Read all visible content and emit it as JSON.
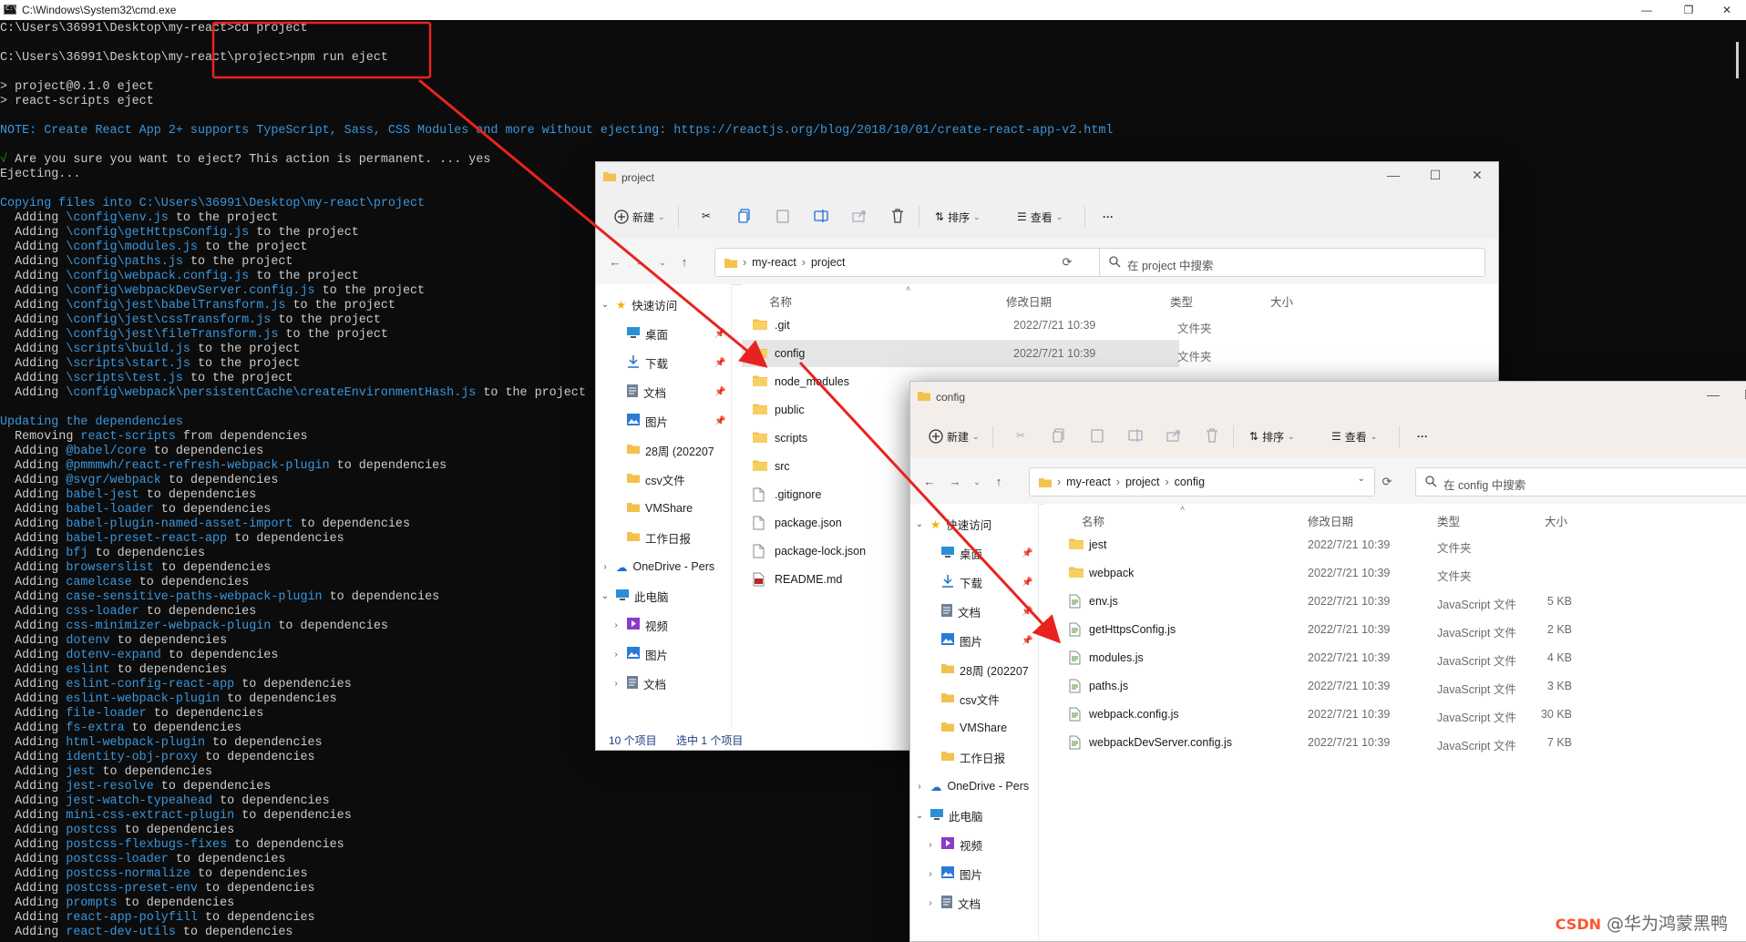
{
  "cmd": {
    "title": "C:\\Windows\\System32\\cmd.exe",
    "controls": {
      "minimize": "—",
      "maximize": "❐",
      "close": "✕"
    },
    "lines": [
      [
        {
          "t": "C:\\Users\\36991\\Desktop\\my-react>cd project",
          "c": ""
        }
      ],
      [
        {
          "t": "",
          "c": ""
        }
      ],
      [
        {
          "t": "C:\\Users\\36991\\Desktop\\my-react\\project>npm run eject",
          "c": ""
        }
      ],
      [
        {
          "t": "",
          "c": ""
        }
      ],
      [
        {
          "t": "> project@0.1.0 eject",
          "c": ""
        }
      ],
      [
        {
          "t": "> react-scripts eject",
          "c": ""
        }
      ],
      [
        {
          "t": "",
          "c": ""
        }
      ],
      [
        {
          "t": "NOTE: Create React App 2+ supports TypeScript, Sass, CSS Modules and more without ejecting: https://reactjs.org/blog/2018/10/01/create-react-app-v2.html",
          "c": "c-cyan"
        }
      ],
      [
        {
          "t": "",
          "c": ""
        }
      ],
      [
        {
          "t": "√ ",
          "c": "c-green"
        },
        {
          "t": "Are you sure you want to eject? This action is permanent. ... yes",
          "c": ""
        }
      ],
      [
        {
          "t": "Ejecting...",
          "c": ""
        }
      ],
      [
        {
          "t": "",
          "c": ""
        }
      ],
      [
        {
          "t": "Copying files into C:\\Users\\36991\\Desktop\\my-react\\project",
          "c": "c-cyan"
        }
      ],
      [
        {
          "t": "  Adding ",
          "c": ""
        },
        {
          "t": "\\config\\env.js",
          "c": "c-cyan"
        },
        {
          "t": " to the project",
          "c": ""
        }
      ],
      [
        {
          "t": "  Adding ",
          "c": ""
        },
        {
          "t": "\\config\\getHttpsConfig.js",
          "c": "c-cyan"
        },
        {
          "t": " to the project",
          "c": ""
        }
      ],
      [
        {
          "t": "  Adding ",
          "c": ""
        },
        {
          "t": "\\config\\modules.js",
          "c": "c-cyan"
        },
        {
          "t": " to the project",
          "c": ""
        }
      ],
      [
        {
          "t": "  Adding ",
          "c": ""
        },
        {
          "t": "\\config\\paths.js",
          "c": "c-cyan"
        },
        {
          "t": " to the project",
          "c": ""
        }
      ],
      [
        {
          "t": "  Adding ",
          "c": ""
        },
        {
          "t": "\\config\\webpack.config.js",
          "c": "c-cyan"
        },
        {
          "t": " to the project",
          "c": ""
        }
      ],
      [
        {
          "t": "  Adding ",
          "c": ""
        },
        {
          "t": "\\config\\webpackDevServer.config.js",
          "c": "c-cyan"
        },
        {
          "t": " to the project",
          "c": ""
        }
      ],
      [
        {
          "t": "  Adding ",
          "c": ""
        },
        {
          "t": "\\config\\jest\\babelTransform.js",
          "c": "c-cyan"
        },
        {
          "t": " to the project",
          "c": ""
        }
      ],
      [
        {
          "t": "  Adding ",
          "c": ""
        },
        {
          "t": "\\config\\jest\\cssTransform.js",
          "c": "c-cyan"
        },
        {
          "t": " to the project",
          "c": ""
        }
      ],
      [
        {
          "t": "  Adding ",
          "c": ""
        },
        {
          "t": "\\config\\jest\\fileTransform.js",
          "c": "c-cyan"
        },
        {
          "t": " to the project",
          "c": ""
        }
      ],
      [
        {
          "t": "  Adding ",
          "c": ""
        },
        {
          "t": "\\scripts\\build.js",
          "c": "c-cyan"
        },
        {
          "t": " to the project",
          "c": ""
        }
      ],
      [
        {
          "t": "  Adding ",
          "c": ""
        },
        {
          "t": "\\scripts\\start.js",
          "c": "c-cyan"
        },
        {
          "t": " to the project",
          "c": ""
        }
      ],
      [
        {
          "t": "  Adding ",
          "c": ""
        },
        {
          "t": "\\scripts\\test.js",
          "c": "c-cyan"
        },
        {
          "t": " to the project",
          "c": ""
        }
      ],
      [
        {
          "t": "  Adding ",
          "c": ""
        },
        {
          "t": "\\config\\webpack\\persistentCache\\createEnvironmentHash.js",
          "c": "c-cyan"
        },
        {
          "t": " to the project",
          "c": ""
        }
      ],
      [
        {
          "t": "",
          "c": ""
        }
      ],
      [
        {
          "t": "Updating the dependencies",
          "c": "c-cyan"
        }
      ],
      [
        {
          "t": "  Removing ",
          "c": ""
        },
        {
          "t": "react-scripts",
          "c": "c-cyan"
        },
        {
          "t": " from dependencies",
          "c": ""
        }
      ],
      [
        {
          "t": "  Adding ",
          "c": ""
        },
        {
          "t": "@babel/core",
          "c": "c-cyan"
        },
        {
          "t": " to dependencies",
          "c": ""
        }
      ],
      [
        {
          "t": "  Adding ",
          "c": ""
        },
        {
          "t": "@pmmmwh/react-refresh-webpack-plugin",
          "c": "c-cyan"
        },
        {
          "t": " to dependencies",
          "c": ""
        }
      ],
      [
        {
          "t": "  Adding ",
          "c": ""
        },
        {
          "t": "@svgr/webpack",
          "c": "c-cyan"
        },
        {
          "t": " to dependencies",
          "c": ""
        }
      ],
      [
        {
          "t": "  Adding ",
          "c": ""
        },
        {
          "t": "babel-jest",
          "c": "c-cyan"
        },
        {
          "t": " to dependencies",
          "c": ""
        }
      ],
      [
        {
          "t": "  Adding ",
          "c": ""
        },
        {
          "t": "babel-loader",
          "c": "c-cyan"
        },
        {
          "t": " to dependencies",
          "c": ""
        }
      ],
      [
        {
          "t": "  Adding ",
          "c": ""
        },
        {
          "t": "babel-plugin-named-asset-import",
          "c": "c-cyan"
        },
        {
          "t": " to dependencies",
          "c": ""
        }
      ],
      [
        {
          "t": "  Adding ",
          "c": ""
        },
        {
          "t": "babel-preset-react-app",
          "c": "c-cyan"
        },
        {
          "t": " to dependencies",
          "c": ""
        }
      ],
      [
        {
          "t": "  Adding ",
          "c": ""
        },
        {
          "t": "bfj",
          "c": "c-cyan"
        },
        {
          "t": " to dependencies",
          "c": ""
        }
      ],
      [
        {
          "t": "  Adding ",
          "c": ""
        },
        {
          "t": "browserslist",
          "c": "c-cyan"
        },
        {
          "t": " to dependencies",
          "c": ""
        }
      ],
      [
        {
          "t": "  Adding ",
          "c": ""
        },
        {
          "t": "camelcase",
          "c": "c-cyan"
        },
        {
          "t": " to dependencies",
          "c": ""
        }
      ],
      [
        {
          "t": "  Adding ",
          "c": ""
        },
        {
          "t": "case-sensitive-paths-webpack-plugin",
          "c": "c-cyan"
        },
        {
          "t": " to dependencies",
          "c": ""
        }
      ],
      [
        {
          "t": "  Adding ",
          "c": ""
        },
        {
          "t": "css-loader",
          "c": "c-cyan"
        },
        {
          "t": " to dependencies",
          "c": ""
        }
      ],
      [
        {
          "t": "  Adding ",
          "c": ""
        },
        {
          "t": "css-minimizer-webpack-plugin",
          "c": "c-cyan"
        },
        {
          "t": " to dependencies",
          "c": ""
        }
      ],
      [
        {
          "t": "  Adding ",
          "c": ""
        },
        {
          "t": "dotenv",
          "c": "c-cyan"
        },
        {
          "t": " to dependencies",
          "c": ""
        }
      ],
      [
        {
          "t": "  Adding ",
          "c": ""
        },
        {
          "t": "dotenv-expand",
          "c": "c-cyan"
        },
        {
          "t": " to dependencies",
          "c": ""
        }
      ],
      [
        {
          "t": "  Adding ",
          "c": ""
        },
        {
          "t": "eslint",
          "c": "c-cyan"
        },
        {
          "t": " to dependencies",
          "c": ""
        }
      ],
      [
        {
          "t": "  Adding ",
          "c": ""
        },
        {
          "t": "eslint-config-react-app",
          "c": "c-cyan"
        },
        {
          "t": " to dependencies",
          "c": ""
        }
      ],
      [
        {
          "t": "  Adding ",
          "c": ""
        },
        {
          "t": "eslint-webpack-plugin",
          "c": "c-cyan"
        },
        {
          "t": " to dependencies",
          "c": ""
        }
      ],
      [
        {
          "t": "  Adding ",
          "c": ""
        },
        {
          "t": "file-loader",
          "c": "c-cyan"
        },
        {
          "t": " to dependencies",
          "c": ""
        }
      ],
      [
        {
          "t": "  Adding ",
          "c": ""
        },
        {
          "t": "fs-extra",
          "c": "c-cyan"
        },
        {
          "t": " to dependencies",
          "c": ""
        }
      ],
      [
        {
          "t": "  Adding ",
          "c": ""
        },
        {
          "t": "html-webpack-plugin",
          "c": "c-cyan"
        },
        {
          "t": " to dependencies",
          "c": ""
        }
      ],
      [
        {
          "t": "  Adding ",
          "c": ""
        },
        {
          "t": "identity-obj-proxy",
          "c": "c-cyan"
        },
        {
          "t": " to dependencies",
          "c": ""
        }
      ],
      [
        {
          "t": "  Adding ",
          "c": ""
        },
        {
          "t": "jest",
          "c": "c-cyan"
        },
        {
          "t": " to dependencies",
          "c": ""
        }
      ],
      [
        {
          "t": "  Adding ",
          "c": ""
        },
        {
          "t": "jest-resolve",
          "c": "c-cyan"
        },
        {
          "t": " to dependencies",
          "c": ""
        }
      ],
      [
        {
          "t": "  Adding ",
          "c": ""
        },
        {
          "t": "jest-watch-typeahead",
          "c": "c-cyan"
        },
        {
          "t": " to dependencies",
          "c": ""
        }
      ],
      [
        {
          "t": "  Adding ",
          "c": ""
        },
        {
          "t": "mini-css-extract-plugin",
          "c": "c-cyan"
        },
        {
          "t": " to dependencies",
          "c": ""
        }
      ],
      [
        {
          "t": "  Adding ",
          "c": ""
        },
        {
          "t": "postcss",
          "c": "c-cyan"
        },
        {
          "t": " to dependencies",
          "c": ""
        }
      ],
      [
        {
          "t": "  Adding ",
          "c": ""
        },
        {
          "t": "postcss-flexbugs-fixes",
          "c": "c-cyan"
        },
        {
          "t": " to dependencies",
          "c": ""
        }
      ],
      [
        {
          "t": "  Adding ",
          "c": ""
        },
        {
          "t": "postcss-loader",
          "c": "c-cyan"
        },
        {
          "t": " to dependencies",
          "c": ""
        }
      ],
      [
        {
          "t": "  Adding ",
          "c": ""
        },
        {
          "t": "postcss-normalize",
          "c": "c-cyan"
        },
        {
          "t": " to dependencies",
          "c": ""
        }
      ],
      [
        {
          "t": "  Adding ",
          "c": ""
        },
        {
          "t": "postcss-preset-env",
          "c": "c-cyan"
        },
        {
          "t": " to dependencies",
          "c": ""
        }
      ],
      [
        {
          "t": "  Adding ",
          "c": ""
        },
        {
          "t": "prompts",
          "c": "c-cyan"
        },
        {
          "t": " to dependencies",
          "c": ""
        }
      ],
      [
        {
          "t": "  Adding ",
          "c": ""
        },
        {
          "t": "react-app-polyfill",
          "c": "c-cyan"
        },
        {
          "t": " to dependencies",
          "c": ""
        }
      ],
      [
        {
          "t": "  Adding ",
          "c": ""
        },
        {
          "t": "react-dev-utils",
          "c": "c-cyan"
        },
        {
          "t": " to dependencies",
          "c": ""
        }
      ]
    ]
  },
  "explorer_project": {
    "title": "project",
    "toolbar": {
      "new": "新建",
      "sort": "排序",
      "view": "查看",
      "more": "···"
    },
    "breadcrumb": [
      "my-react",
      "project"
    ],
    "search_placeholder": "在 project 中搜索",
    "columns": {
      "name": "名称",
      "date": "修改日期",
      "type": "类型",
      "size": "大小"
    },
    "nav": {
      "quick_access": "快速访问",
      "items": [
        "桌面",
        "下载",
        "文档",
        "图片",
        "28周 (202207",
        "csv文件",
        "VMShare",
        "工作日报"
      ],
      "onedrive": "OneDrive - Pers",
      "this_pc": "此电脑",
      "pc_items": [
        "视频",
        "图片",
        "文档"
      ]
    },
    "files": [
      {
        "name": ".git",
        "date": "2022/7/21 10:39",
        "type": "文件夹",
        "kind": "folder"
      },
      {
        "name": "config",
        "date": "2022/7/21 10:39",
        "type": "文件夹",
        "kind": "folder",
        "selected": true
      },
      {
        "name": "node_modules",
        "date": "",
        "type": "",
        "kind": "folder"
      },
      {
        "name": "public",
        "date": "",
        "type": "",
        "kind": "folder"
      },
      {
        "name": "scripts",
        "date": "",
        "type": "",
        "kind": "folder"
      },
      {
        "name": "src",
        "date": "",
        "type": "",
        "kind": "folder"
      },
      {
        "name": ".gitignore",
        "date": "",
        "type": "",
        "kind": "file"
      },
      {
        "name": "package.json",
        "date": "",
        "type": "",
        "kind": "file"
      },
      {
        "name": "package-lock.json",
        "date": "",
        "type": "",
        "kind": "file"
      },
      {
        "name": "README.md",
        "date": "",
        "type": "",
        "kind": "md"
      }
    ],
    "status": {
      "count": "10 个项目",
      "selected": "选中 1 个项目"
    }
  },
  "explorer_config": {
    "title": "config",
    "toolbar": {
      "new": "新建",
      "sort": "排序",
      "view": "查看",
      "more": "···"
    },
    "breadcrumb": [
      "my-react",
      "project",
      "config"
    ],
    "search_placeholder": "在 config 中搜索",
    "columns": {
      "name": "名称",
      "date": "修改日期",
      "type": "类型",
      "size": "大小"
    },
    "nav": {
      "quick_access": "快速访问",
      "items": [
        "桌面",
        "下载",
        "文档",
        "图片",
        "28周 (202207",
        "csv文件",
        "VMShare",
        "工作日报"
      ],
      "onedrive": "OneDrive - Pers",
      "this_pc": "此电脑",
      "pc_items": [
        "视频",
        "图片",
        "文档"
      ]
    },
    "files": [
      {
        "name": "jest",
        "date": "2022/7/21 10:39",
        "type": "文件夹",
        "size": "",
        "kind": "folder"
      },
      {
        "name": "webpack",
        "date": "2022/7/21 10:39",
        "type": "文件夹",
        "size": "",
        "kind": "folder"
      },
      {
        "name": "env.js",
        "date": "2022/7/21 10:39",
        "type": "JavaScript 文件",
        "size": "5 KB",
        "kind": "js"
      },
      {
        "name": "getHttpsConfig.js",
        "date": "2022/7/21 10:39",
        "type": "JavaScript 文件",
        "size": "2 KB",
        "kind": "js"
      },
      {
        "name": "modules.js",
        "date": "2022/7/21 10:39",
        "type": "JavaScript 文件",
        "size": "4 KB",
        "kind": "js"
      },
      {
        "name": "paths.js",
        "date": "2022/7/21 10:39",
        "type": "JavaScript 文件",
        "size": "3 KB",
        "kind": "js"
      },
      {
        "name": "webpack.config.js",
        "date": "2022/7/21 10:39",
        "type": "JavaScript 文件",
        "size": "30 KB",
        "kind": "js"
      },
      {
        "name": "webpackDevServer.config.js",
        "date": "2022/7/21 10:39",
        "type": "JavaScript 文件",
        "size": "7 KB",
        "kind": "js"
      }
    ]
  },
  "watermark": {
    "brand": "CSDN",
    "text": "@华为鸿蒙黑鸭"
  },
  "colors": {
    "annotation_red": "#e8231f",
    "cmd_bg": "#0c0c0c",
    "cmd_text": "#cccccc",
    "cmd_cyan": "#3a96dd",
    "folder_yellow": "#f2c14e"
  }
}
